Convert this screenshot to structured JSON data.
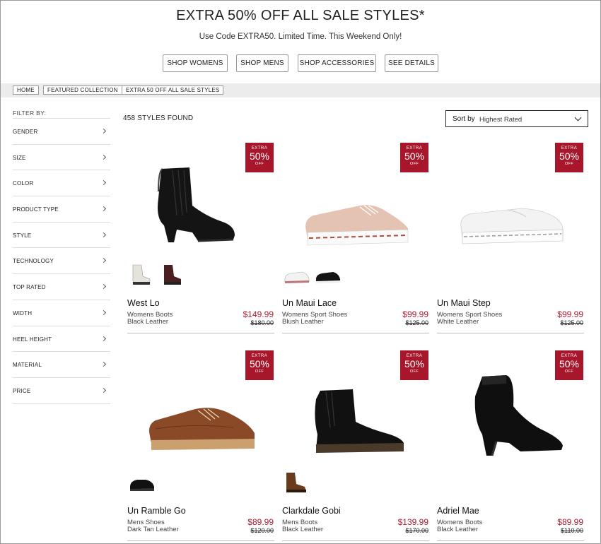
{
  "promo": {
    "title": "EXTRA 50% OFF ALL SALE STYLES*",
    "subtitle": "Use Code EXTRA50. Limited Time. This Weekend Only!",
    "buttons": [
      "SHOP WOMENS",
      "SHOP MENS",
      "SHOP ACCESSORIES",
      "SEE DETAILS"
    ]
  },
  "breadcrumb": [
    "HOME",
    "FEATURED COLLECTION",
    "EXTRA 50 OFF ALL SALE STYLES"
  ],
  "sidebar": {
    "heading": "FILTER BY:",
    "filters": [
      "GENDER",
      "SIZE",
      "COLOR",
      "PRODUCT TYPE",
      "STYLE",
      "TECHNOLOGY",
      "TOP RATED",
      "WIDTH",
      "HEEL HEIGHT",
      "MATERIAL",
      "PRICE"
    ]
  },
  "results": {
    "count": "458 STYLES FOUND",
    "sort_label": "Sort by",
    "sort_value": "Highest Rated"
  },
  "badge": {
    "line1": "EXTRA",
    "line2": "50%",
    "line3": "OFF"
  },
  "colors": {
    "accent": "#a8162b",
    "sale_price": "#b01a2e"
  },
  "products": [
    {
      "name": "West Lo",
      "category": "Womens Boots",
      "color": "Black Leather",
      "sale": "$149.99",
      "original": "$180.00",
      "icon": "black-chelsea-heel-boot",
      "swatches": [
        "white-boot",
        "burgundy-boot"
      ]
    },
    {
      "name": "Un Maui Lace",
      "category": "Womens Sport Shoes",
      "color": "Blush Leather",
      "sale": "$99.99",
      "original": "$125.00",
      "icon": "blush-lace-sneaker",
      "swatches": [
        "white-sneaker",
        "black-sneaker"
      ]
    },
    {
      "name": "Un Maui Step",
      "category": "Womens Sport Shoes",
      "color": "White Leather",
      "sale": "$99.99",
      "original": "$125.00",
      "icon": "white-slip-on",
      "swatches": []
    },
    {
      "name": "Un Ramble Go",
      "category": "Mens Shoes",
      "color": "Dark Tan Leather",
      "sale": "$89.99",
      "original": "$120.00",
      "icon": "tan-lace-shoe",
      "swatches": [
        "black-shoe"
      ]
    },
    {
      "name": "Clarkdale Gobi",
      "category": "Mens Boots",
      "color": "Black Leather",
      "sale": "$139.99",
      "original": "$170.00",
      "icon": "black-chelsea-boot",
      "swatches": [
        "brown-chelsea-boot"
      ]
    },
    {
      "name": "Adriel Mae",
      "category": "Womens Boots",
      "color": "Black Leather",
      "sale": "$89.99",
      "original": "$110.00",
      "icon": "black-heel-bootie",
      "swatches": []
    }
  ]
}
